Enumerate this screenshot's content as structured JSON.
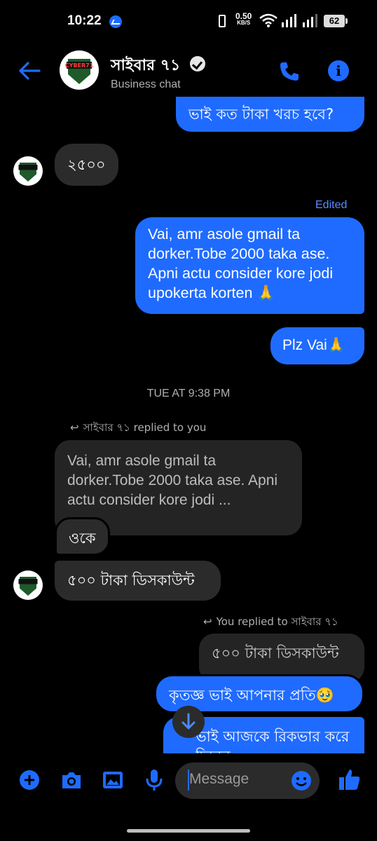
{
  "status_bar": {
    "time": "10:22",
    "net_speed_value": "0.50",
    "net_speed_unit": "KB/S",
    "battery": "62"
  },
  "header": {
    "name": "সাইবার ৭১",
    "subtitle": "Business chat",
    "avatar_text": "CYBER71"
  },
  "messages": {
    "m1": "ভাই কত টাকা খরচ হবে?",
    "m2": "২৫০০",
    "edited_label": "Edited",
    "m3": "Vai, amr asole gmail ta dorker.Tobe 2000 taka ase. Apni actu consider kore jodi upokerta korten 🙏",
    "m4": "Plz Vai🙏",
    "time_separator": "TUE AT 9:38 PM",
    "reply_note_1": "সাইবার ৭১ replied to you",
    "quote_1": "Vai, amr asole gmail ta dorker.Tobe 2000 taka ase. Apni actu consider kore jodi ...",
    "m5": "ওকে",
    "m6": "৫০০ টাকা ডিসকাউন্ট",
    "reply_note_2": "You replied to সাইবার ৭১",
    "quote_2": "৫০০ টাকা ডিসকাউন্ট",
    "m7": "কৃতজ্ঞ ভাই আপনার প্রতি🥹",
    "m8": "ভাই আজকে রিকভার করে দিবেন"
  },
  "composer": {
    "placeholder": "Message"
  },
  "colors": {
    "accent": "#1f6bff",
    "incoming_bubble": "#2b2b2b",
    "background": "#000000"
  },
  "icons": {
    "back": "back-arrow-icon",
    "call": "phone-icon",
    "info": "info-icon",
    "add": "plus-circle-icon",
    "camera": "camera-icon",
    "gallery": "image-icon",
    "mic": "microphone-icon",
    "emoji": "emoji-icon",
    "like": "thumbs-up-icon",
    "scroll": "arrow-down-icon"
  }
}
